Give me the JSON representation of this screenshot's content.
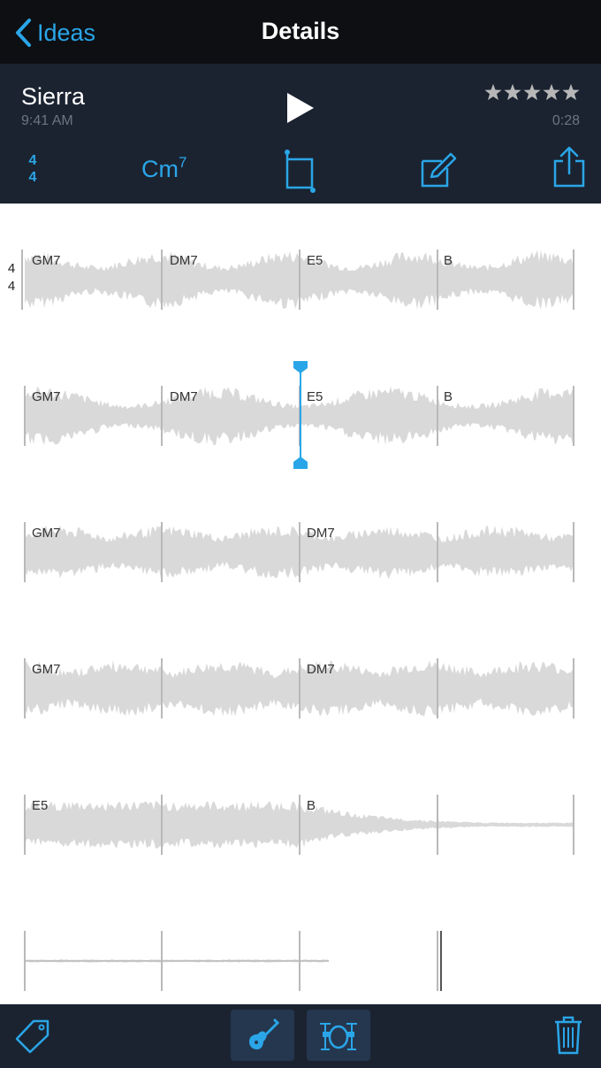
{
  "nav": {
    "back_label": "Ideas",
    "title": "Details"
  },
  "song": {
    "name": "Sierra",
    "time": "9:41 AM",
    "duration": "0:28",
    "rating": 5
  },
  "toolbar": {
    "time_signature_top": "4",
    "time_signature_bottom": "4",
    "chord_root": "Cm",
    "chord_ext": "7"
  },
  "rows": [
    {
      "chords": [
        "GM7",
        "DM7",
        "E5",
        "B"
      ],
      "show_time_signature": true
    },
    {
      "chords": [
        "GM7",
        "DM7",
        "E5",
        "B"
      ]
    },
    {
      "chords": [
        "GM7",
        "",
        "DM7",
        ""
      ]
    },
    {
      "chords": [
        "GM7",
        "",
        "DM7",
        ""
      ]
    },
    {
      "chords": [
        "E5",
        "",
        "B",
        ""
      ]
    },
    {
      "chords": [
        "",
        "",
        "",
        ""
      ]
    }
  ],
  "staff": {
    "top": "4",
    "bottom": "4"
  },
  "playhead_row": 1,
  "colors": {
    "accent": "#2aa6e8",
    "header_bg": "#1b2331",
    "wave": "#d9d9d9"
  }
}
